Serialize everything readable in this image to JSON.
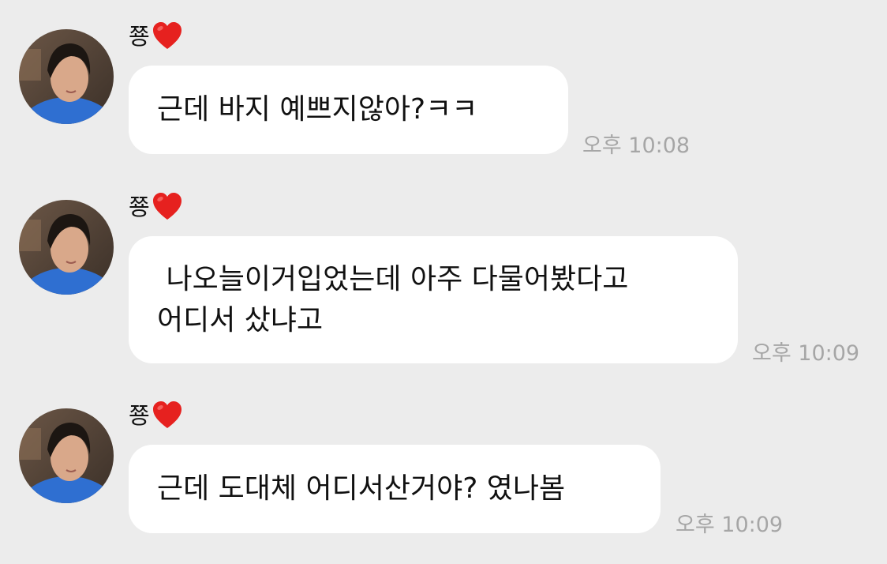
{
  "messages": [
    {
      "sender": "쭁",
      "text": "근데 바지 예쁘지않아?ㅋㅋ",
      "time": "오후 10:08"
    },
    {
      "sender": "쭁",
      "text": " 나오늘이거입었는데 아주 다물어봤다고\n어디서 샀냐고",
      "time": "오후 10:09"
    },
    {
      "sender": "쭁",
      "text": "근데 도대체 어디서산거야? 였나봄",
      "time": "오후 10:09"
    }
  ],
  "colors": {
    "background": "#ececec",
    "bubble": "#ffffff",
    "timestamp": "#a6a6a6",
    "heart": "#e6211f"
  },
  "icons": {
    "heart": "red-heart-emoji",
    "avatar": "profile-photo"
  }
}
